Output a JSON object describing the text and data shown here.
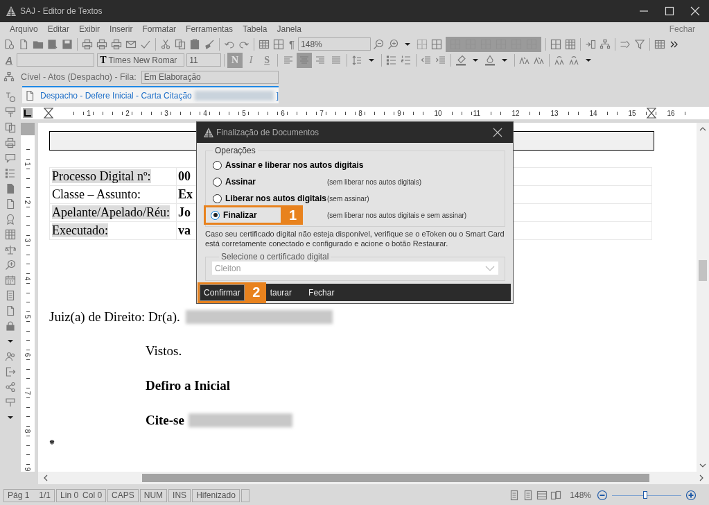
{
  "window": {
    "title": "SAJ - Editor de Textos"
  },
  "menu": [
    "Arquivo",
    "Editar",
    "Exibir",
    "Inserir",
    "Formatar",
    "Ferramentas",
    "Tabela",
    "Janela"
  ],
  "menu_close": "Fechar",
  "toolbar": {
    "pilcrow": "¶",
    "zoom": "148%",
    "style_icon": "A",
    "font_icon": "T",
    "font": "Times New Romar",
    "size": "11",
    "format_buttons": [
      {
        "label": "N",
        "pressed": true
      },
      {
        "label": "I",
        "pressed": false
      },
      {
        "label": "S",
        "pressed": false
      }
    ],
    "alignment_buttons": [
      {
        "selected": false
      },
      {
        "selected": true
      },
      {
        "selected": false
      },
      {
        "selected": false
      }
    ]
  },
  "context": {
    "label": "Cível - Atos (Despacho) - Fila:",
    "queue": "Em Elaboração"
  },
  "document_tab": {
    "title": "Despacho - Defere Inicial - Carta Citação",
    "title_end": "]",
    "selected": true
  },
  "ruler": {
    "labels": [
      "1",
      "2",
      "3",
      "4",
      "5",
      "6",
      "7",
      "8",
      "9",
      "10",
      "11",
      "12",
      "13",
      "14",
      "15",
      "16"
    ]
  },
  "vertical_ruler": {
    "labels": [
      "1",
      "2",
      "3",
      "4",
      "5",
      "6",
      "7",
      "8",
      "9"
    ]
  },
  "document": {
    "table": [
      {
        "label": "Processo Digital nº:",
        "value": "00",
        "highlighted": true
      },
      {
        "label": "Classe – Assunto:",
        "value": "Ex",
        "highlighted": false
      },
      {
        "label": "Apelante/Apelado/Réu:",
        "value": "Jo",
        "highlighted": true
      },
      {
        "label": "Executado:",
        "value": "va",
        "highlighted": true
      }
    ],
    "judge": {
      "text": "Juiz(a) de Direito: Dr(a).",
      "redacted": true
    },
    "paragraphs": [
      {
        "text": "Vistos.",
        "bold": false,
        "redacted": false
      },
      {
        "text": "Defiro a Inicial",
        "bold": true,
        "redacted": false
      },
      {
        "text": "Cite-se",
        "bold": true,
        "redacted": true
      }
    ],
    "mark": "*"
  },
  "dialog": {
    "title": "Finalização de Documentos",
    "group": "Operações",
    "options": [
      {
        "label": "Assinar e liberar nos autos digitais",
        "selected": false
      },
      {
        "label": "Assinar",
        "hint": "(sem liberar nos autos digitais)",
        "selected": false
      },
      {
        "label": "Liberar nos autos digitais",
        "hint": "(sem assinar)",
        "selected": false
      },
      {
        "label": "Finalizar",
        "hint": "(sem liberar nos autos digitais e sem assinar)",
        "selected": true,
        "callout": "1"
      }
    ],
    "note": "Caso seu certificado digital não esteja disponível, verifique se o eToken ou o Smart Card está corretamente conectado e configurado e acione o botão Restaurar.",
    "certificate_group": "Selecione o certificado digital",
    "certificate": "Cleiton",
    "buttons": [
      {
        "label": "Confirmar",
        "focused": true,
        "callout": "2"
      },
      {
        "label": "taurar",
        "focused": false
      },
      {
        "label": "Fechar",
        "focused": false
      }
    ]
  },
  "status_bar": {
    "page": "Pág 1",
    "pages": "1/1",
    "line": "Lin 0",
    "column": "Col 0",
    "indicators": [
      "CAPS",
      "NUM",
      "INS",
      "Hifenizado"
    ],
    "zoom": "148%",
    "zoom_slider": {
      "level": 0.48
    }
  }
}
